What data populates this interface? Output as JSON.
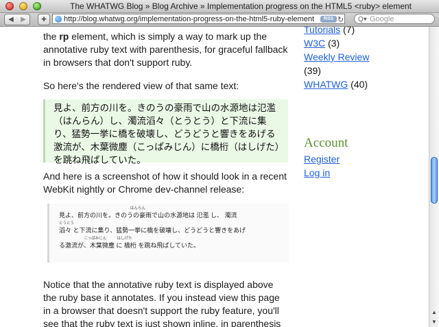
{
  "window": {
    "title": "The WHATWG Blog » Blog Archive » Implementation progress on the HTML5 <ruby> element"
  },
  "toolbar": {
    "back_glyph": "◀",
    "forward_glyph": "▶",
    "add_glyph": "+",
    "url": "http://blog.whatwg.org/implementation-progress-on-the-html5-ruby-element",
    "rss_label": "RSS",
    "reload_glyph": "↻",
    "search_placeholder": "Google",
    "search_icon_glyph": "Q▾"
  },
  "article": {
    "p1_a": "the ",
    "p1_bold": "rp",
    "p1_b": " element, which is simply a way to mark up the annotative ruby text with parenthesis, for graceful fallback in browsers that don't support ruby.",
    "p2": "So here's the rendered view of that same text:",
    "quote": "見よ、前方の川を。きのうの豪雨で山の水源地は氾濫（はんらん）し、濁流滔々（とうとう）と下流に集り、猛勢一挙に橋を破壊し、どうどうと響きをあげる激流が、木葉微塵（こっぱみじん）に橋桁（はしげた）を跳ね飛ばしていた。",
    "p3": "And here is a screenshot of how it should look in a recent WebKit nightly or Chrome dev-channel release:",
    "screenshot_lines": [
      {
        "ruby": "                                                                    はんらん",
        "base": "見よ、前方の川を。きのうの豪雨で山の水源地は 氾濫 し、 濁流"
      },
      {
        "ruby": "とうとう",
        "base": "滔々 と下流に集り、猛勢一挙に橋を破壊し、どうどうと響きをあげ"
      },
      {
        "ruby": "                        こっぱみじん          はしげた",
        "base": "る激流が、木葉微塵 に 橋桁 を跳ね飛ばしていた。"
      }
    ],
    "p4": "Notice that the annotative ruby text is displayed above the ruby base it annotates. If you instead view this page in a browser that doesn't support the ruby feature, you'll see that the ruby text is just shown inline, in parenthesis"
  },
  "sidebar": {
    "tutorials_link": "Tutorials",
    "tutorials_count": " (7)",
    "w3c_link": "W3C",
    "w3c_count": " (3)",
    "weekly_link": "Weekly Review",
    "weekly_count": "(39)",
    "whatwg_link": "WHATWG",
    "whatwg_count": " (40)",
    "account_heading": "Account",
    "register_link": "Register",
    "login_link": "Log in"
  },
  "scrollbar": {
    "up_glyph": "▲",
    "down_glyph": "▼"
  }
}
